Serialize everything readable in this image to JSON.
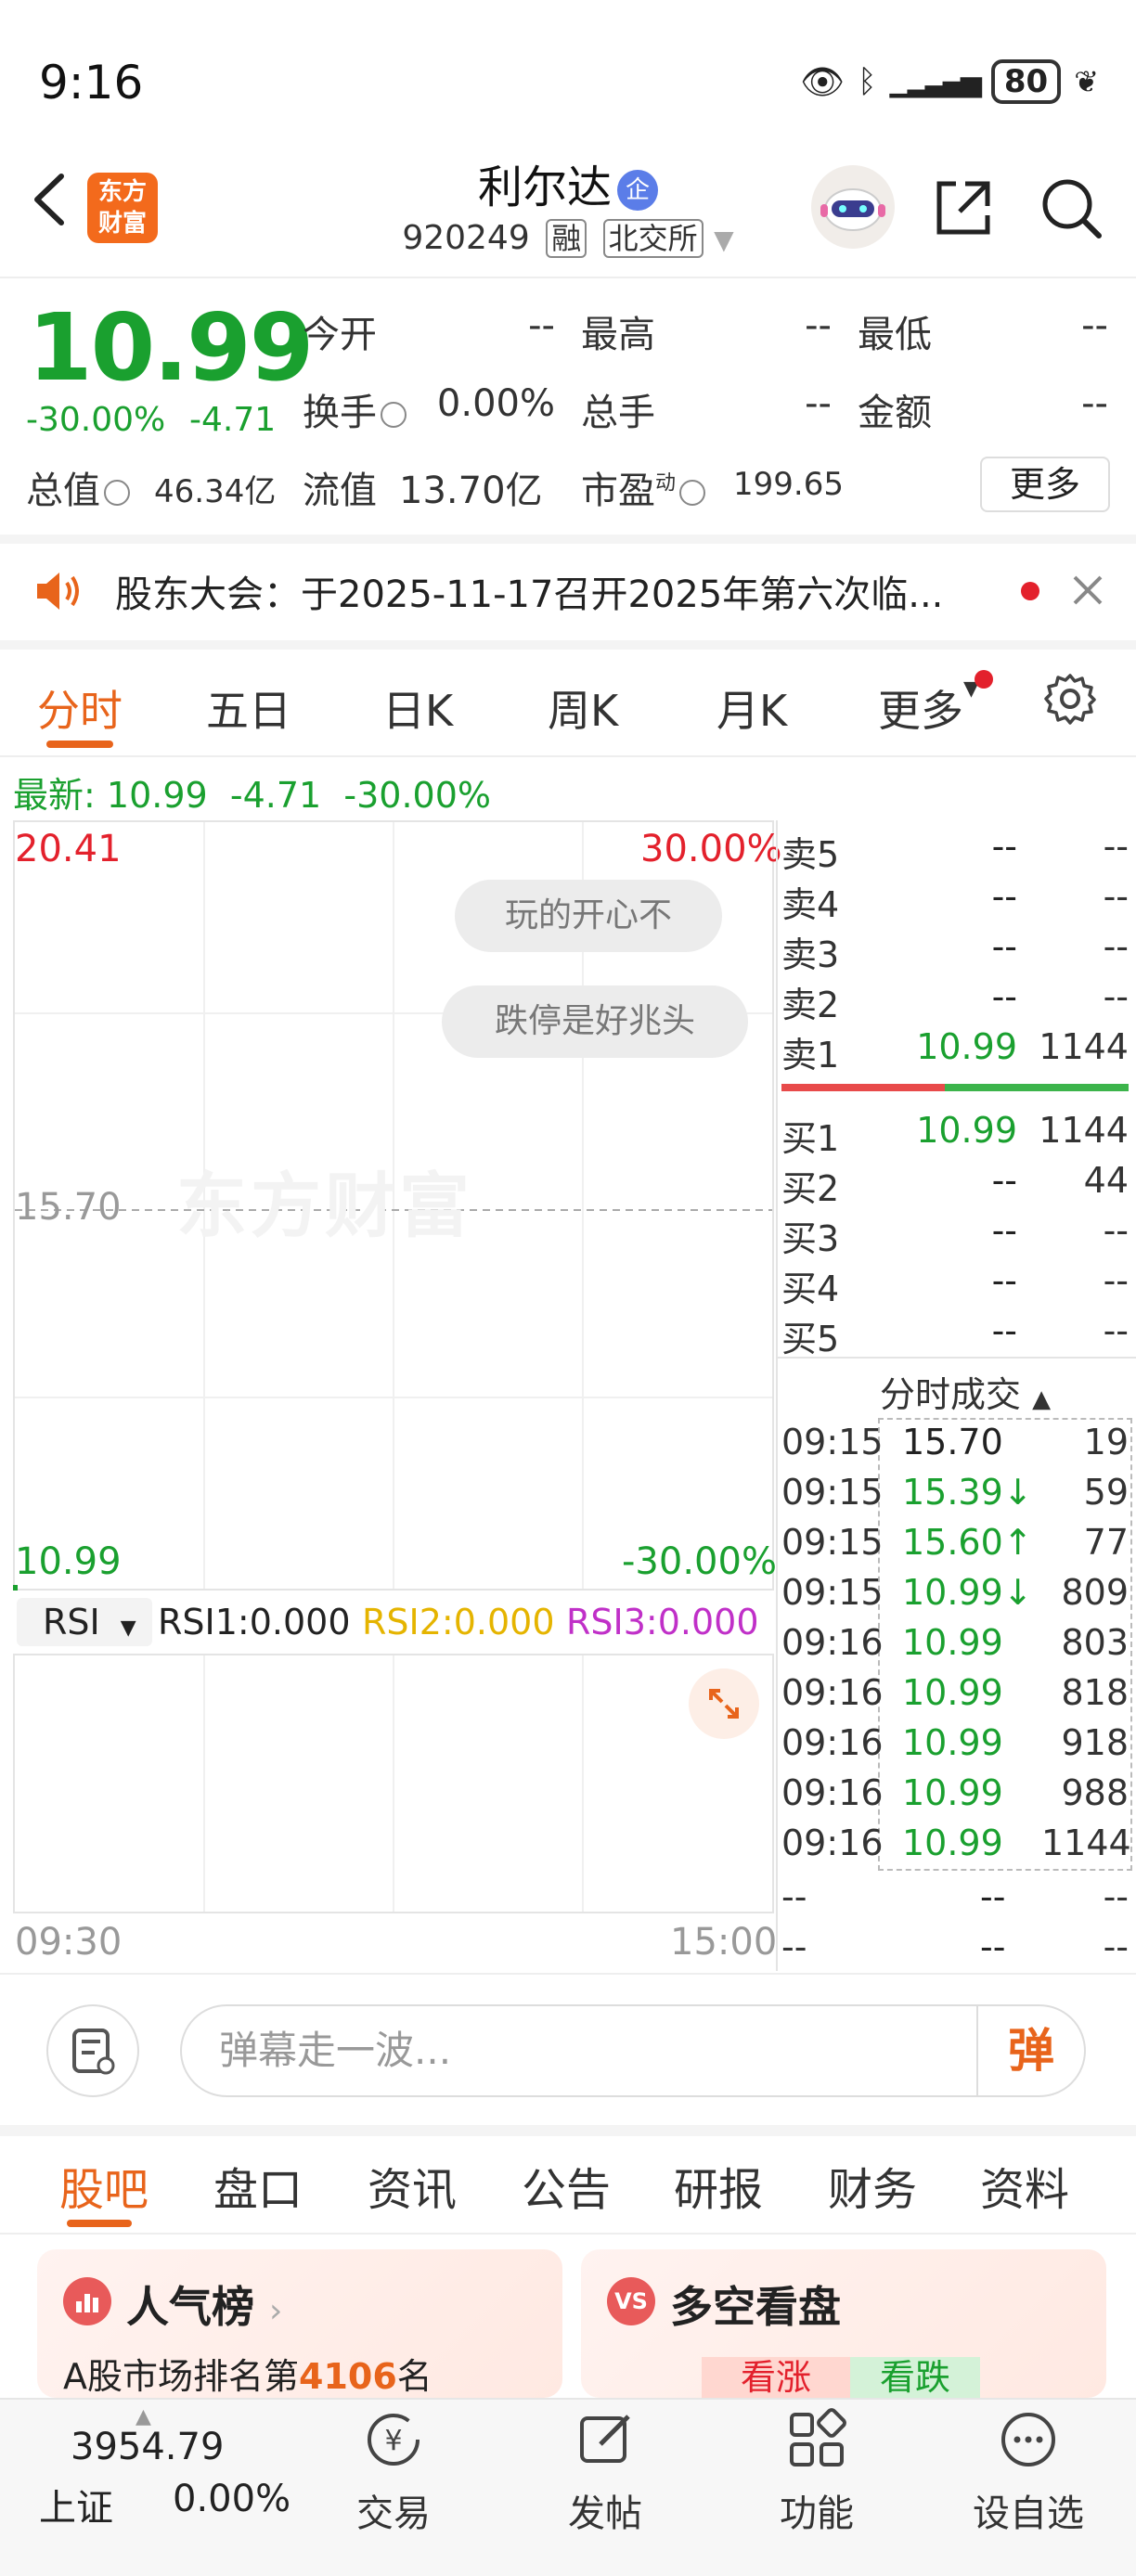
{
  "status": {
    "time": "9:16",
    "battery": "80"
  },
  "header": {
    "logo_line1": "东方",
    "logo_line2": "财富",
    "name": "利尔达",
    "name_badge": "企",
    "code": "920249",
    "tag_margin": "融",
    "tag_exchange": "北交所"
  },
  "quote": {
    "price": "10.99",
    "change_pct": "-30.00%",
    "change": "-4.71",
    "fields": [
      {
        "label": "今开",
        "value": "--"
      },
      {
        "label": "最高",
        "value": "--"
      },
      {
        "label": "最低",
        "value": "--"
      },
      {
        "label": "换手",
        "value": "0.00%"
      },
      {
        "label": "总手",
        "value": "--"
      },
      {
        "label": "金额",
        "value": "--"
      },
      {
        "label": "总值",
        "value": "46.34亿"
      },
      {
        "label": "流值",
        "value": "13.70亿"
      },
      {
        "label": "市盈",
        "sup": "动",
        "value": "199.65"
      }
    ],
    "more_label": "更多"
  },
  "notice": {
    "text": "股东大会：于2025-11-17召开2025年第六次临..."
  },
  "period_tabs": [
    "分时",
    "五日",
    "日K",
    "周K",
    "月K",
    "更多"
  ],
  "latest": {
    "label": "最新:",
    "price": "10.99",
    "change": "-4.71",
    "pct": "-30.00%"
  },
  "chart": {
    "y_high": "20.41",
    "y_mid": "15.70",
    "y_low": "10.99",
    "pct_high": "30.00%",
    "pct_low": "-30.00%",
    "x_start": "09:30",
    "x_end": "15:00",
    "watermark": "东方财富",
    "danmu": [
      "玩的开心不",
      "跌停是好兆头"
    ],
    "rsi_select": "RSI",
    "rsi1": "RSI1:0.000",
    "rsi2": "RSI2:0.000",
    "rsi3": "RSI3:0.000",
    "colors": {
      "rsi2": "#e5b400",
      "rsi3": "#c030c8"
    }
  },
  "order_book": {
    "asks": [
      {
        "label": "卖5",
        "price": "--",
        "volume": "--"
      },
      {
        "label": "卖4",
        "price": "--",
        "volume": "--"
      },
      {
        "label": "卖3",
        "price": "--",
        "volume": "--"
      },
      {
        "label": "卖2",
        "price": "--",
        "volume": "--"
      },
      {
        "label": "卖1",
        "price": "10.99",
        "volume": "1144"
      }
    ],
    "bids": [
      {
        "label": "买1",
        "price": "10.99",
        "volume": "1144"
      },
      {
        "label": "买2",
        "price": "--",
        "volume": "44"
      },
      {
        "label": "买3",
        "price": "--",
        "volume": "--"
      },
      {
        "label": "买4",
        "price": "--",
        "volume": "--"
      },
      {
        "label": "买5",
        "price": "--",
        "volume": "--"
      }
    ]
  },
  "ticks": {
    "title": "分时成交",
    "rows": [
      {
        "time": "09:15",
        "price": "15.70",
        "volume": "19"
      },
      {
        "time": "09:15",
        "price": "15.39↓",
        "volume": "59"
      },
      {
        "time": "09:15",
        "price": "15.60↑",
        "volume": "77"
      },
      {
        "time": "09:15",
        "price": "10.99↓",
        "volume": "809"
      },
      {
        "time": "09:16",
        "price": "10.99",
        "volume": "803"
      },
      {
        "time": "09:16",
        "price": "10.99",
        "volume": "818"
      },
      {
        "time": "09:16",
        "price": "10.99",
        "volume": "918"
      },
      {
        "time": "09:16",
        "price": "10.99",
        "volume": "988"
      },
      {
        "time": "09:16",
        "price": "10.99",
        "volume": "1144"
      },
      {
        "time": "--",
        "price": "--",
        "volume": "--"
      },
      {
        "time": "--",
        "price": "--",
        "volume": "--"
      }
    ]
  },
  "comment": {
    "placeholder": "弹幕走一波...",
    "button": "弹"
  },
  "content_tabs": [
    "股吧",
    "盘口",
    "资讯",
    "公告",
    "研报",
    "财务",
    "资料"
  ],
  "cards": {
    "left_title": "人气榜",
    "left_sub_prefix": "A股市场排名第",
    "left_rank": "4106",
    "left_sub_suffix": "名",
    "right_title": "多空看盘",
    "right_up": "看涨",
    "right_down": "看跌"
  },
  "bottom_nav": {
    "index_value": "3954.79",
    "index_name": "上证",
    "index_pct": "0.00%",
    "items": [
      "交易",
      "发帖",
      "功能",
      "设自选"
    ]
  }
}
